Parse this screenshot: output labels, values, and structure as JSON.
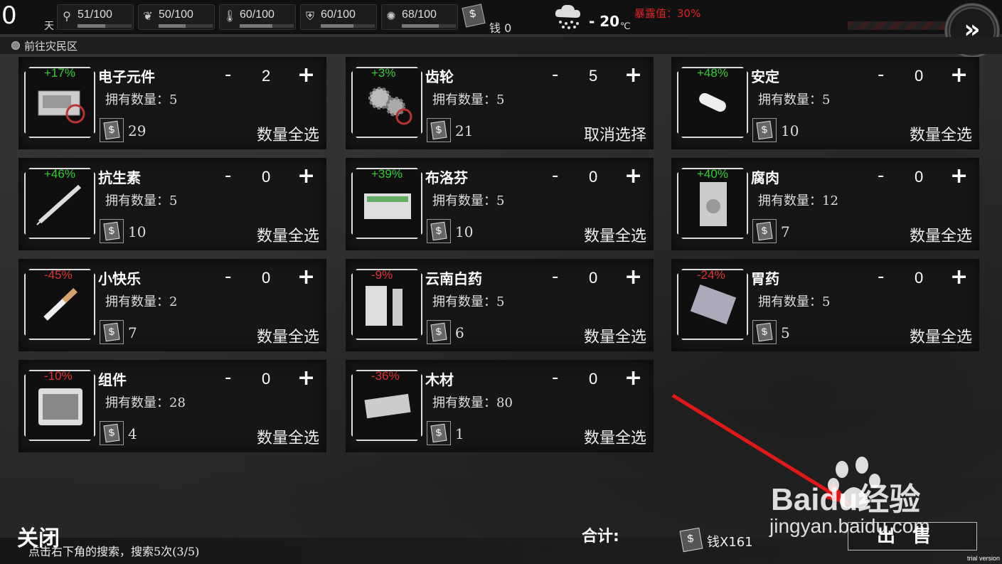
{
  "top": {
    "day": "0",
    "day_label": "天",
    "stats": [
      {
        "icon": "feet-icon",
        "value": "51/100",
        "fill": 0.51
      },
      {
        "icon": "stomach-icon",
        "value": "50/100",
        "fill": 0.5
      },
      {
        "icon": "thermometer-icon",
        "value": "60/100",
        "fill": 0.6
      },
      {
        "icon": "health-shield-icon",
        "value": "60/100",
        "fill": 0.6
      },
      {
        "icon": "mood-icon",
        "value": "68/100",
        "fill": 0.68
      }
    ],
    "money_label": "钱 0",
    "weather_icon": "snow-cloud-icon",
    "temperature": "- 20",
    "temperature_unit": "℃",
    "exposure": "暴露值：30%"
  },
  "location": {
    "label": "前往灾民区"
  },
  "items": [
    {
      "name": "电子元件",
      "pct": "+17%",
      "trend": "up",
      "owned": "拥有数量：5",
      "qty": "2",
      "price": "29",
      "action": "数量全选",
      "icon": "electronics-icon"
    },
    {
      "name": "齿轮",
      "pct": "+3%",
      "trend": "up",
      "owned": "拥有数量：5",
      "qty": "5",
      "price": "21",
      "action": "取消选择",
      "icon": "gears-icon"
    },
    {
      "name": "安定",
      "pct": "+48%",
      "trend": "up",
      "owned": "拥有数量：5",
      "qty": "0",
      "price": "10",
      "action": "数量全选",
      "icon": "pill-icon"
    },
    {
      "name": "抗生素",
      "pct": "+46%",
      "trend": "up",
      "owned": "拥有数量：5",
      "qty": "0",
      "price": "10",
      "action": "数量全选",
      "icon": "syringe-icon"
    },
    {
      "name": "布洛芬",
      "pct": "+39%",
      "trend": "up",
      "owned": "拥有数量：5",
      "qty": "0",
      "price": "10",
      "action": "数量全选",
      "icon": "medicine-box-icon"
    },
    {
      "name": "腐肉",
      "pct": "+40%",
      "trend": "up",
      "owned": "拥有数量：12",
      "qty": "0",
      "price": "7",
      "action": "数量全选",
      "icon": "meat-pack-icon"
    },
    {
      "name": "小快乐",
      "pct": "-45%",
      "trend": "down",
      "owned": "拥有数量：2",
      "qty": "0",
      "price": "7",
      "action": "数量全选",
      "icon": "cigarette-icon"
    },
    {
      "name": "云南白药",
      "pct": "-9%",
      "trend": "down",
      "owned": "拥有数量：5",
      "qty": "0",
      "price": "6",
      "action": "数量全选",
      "icon": "medicine-spray-icon"
    },
    {
      "name": "胃药",
      "pct": "-24%",
      "trend": "down",
      "owned": "拥有数量：5",
      "qty": "0",
      "price": "5",
      "action": "数量全选",
      "icon": "blister-pack-icon"
    },
    {
      "name": "组件",
      "pct": "-10%",
      "trend": "down",
      "owned": "拥有数量：28",
      "qty": "0",
      "price": "4",
      "action": "数量全选",
      "icon": "toolkit-icon"
    },
    {
      "name": "木材",
      "pct": "-36%",
      "trend": "down",
      "owned": "拥有数量：80",
      "qty": "0",
      "price": "1",
      "action": "数量全选",
      "icon": "wood-planks-icon"
    }
  ],
  "controls": {
    "minus": "-",
    "plus": "+"
  },
  "bottom": {
    "close": "关闭",
    "hint": "点击右下角的搜索，搜索5次(3/5)",
    "total_label": "合计:",
    "total_value": "钱X161",
    "sell": "出售",
    "trial": "trial version"
  },
  "watermark": {
    "brand": "Baidu经验",
    "url": "jingyan.baidu.com"
  },
  "colors": {
    "up": "#33cc33",
    "down": "#dd3333",
    "exposure": "#dd2222"
  }
}
